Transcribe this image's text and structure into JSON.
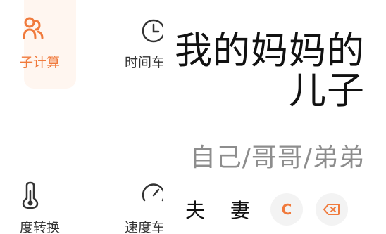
{
  "tiles": {
    "relation_calc": {
      "label": "亲戚计算",
      "visible_label": "子计算"
    },
    "time_convert": {
      "label": "时间转换",
      "visible_label": "时间车"
    },
    "temp_convert": {
      "label": "温度转换",
      "visible_label": "度转换"
    },
    "speed_convert": {
      "label": "速度转换",
      "visible_label": "速度车"
    }
  },
  "calculator": {
    "expression": "我的妈妈的儿子",
    "result": "自己/哥哥/弟弟",
    "keys": {
      "husband": "夫",
      "wife": "妻",
      "clear": "C",
      "backspace_icon": "backspace-icon"
    }
  },
  "colors": {
    "accent": "#f07a3c",
    "active_tile_bg": "#fff6f0",
    "result_text": "#8d8d8d",
    "key_bg": "#f3f3f3"
  }
}
